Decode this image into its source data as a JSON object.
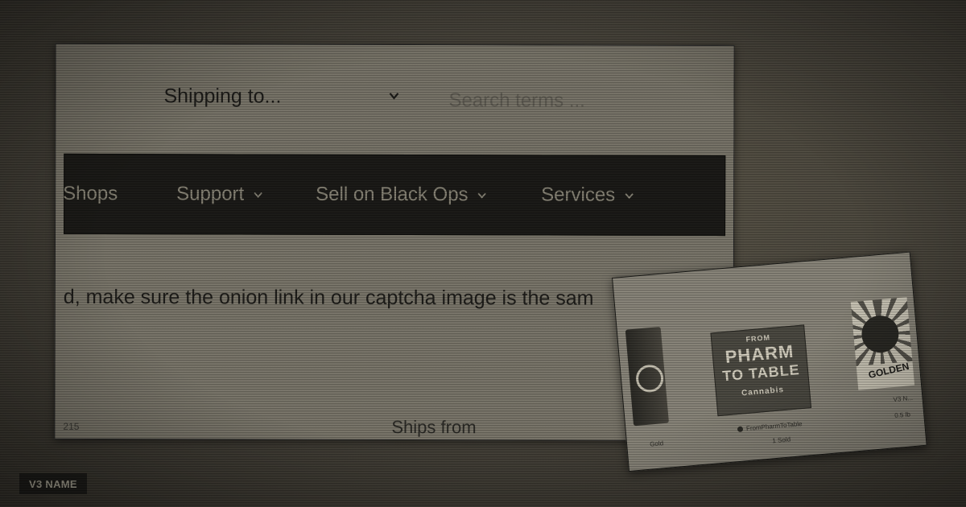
{
  "header": {
    "shipping_label": "Shipping to...",
    "search_placeholder": "Search terms ..."
  },
  "nav": {
    "items": [
      {
        "label": "Shops",
        "has_dropdown": false
      },
      {
        "label": "Support",
        "has_dropdown": true
      },
      {
        "label": "Sell on Black Ops",
        "has_dropdown": true
      },
      {
        "label": "Services",
        "has_dropdown": true
      }
    ]
  },
  "notice": {
    "text": "d, make sure the onion link in our captcha image is the sam"
  },
  "listing": {
    "ships_from_label": "Ships from",
    "corner_count": "215"
  },
  "card": {
    "product2_lines": [
      "FROM",
      "PHARM",
      "TO TABLE",
      "Cannabis"
    ],
    "product3_label": "GOLDEN",
    "vendor_left": "Gold",
    "vendor_center": "FromPharmToTable",
    "vendor_right": "V3 N...",
    "sold": "1 Sold",
    "price_right": "0.5 lb"
  },
  "badge": {
    "label": "V3 NAME"
  },
  "colors": {
    "nav_bg": "#1b1a17",
    "page_bg": "#7c786c",
    "tint": "#48443b"
  }
}
